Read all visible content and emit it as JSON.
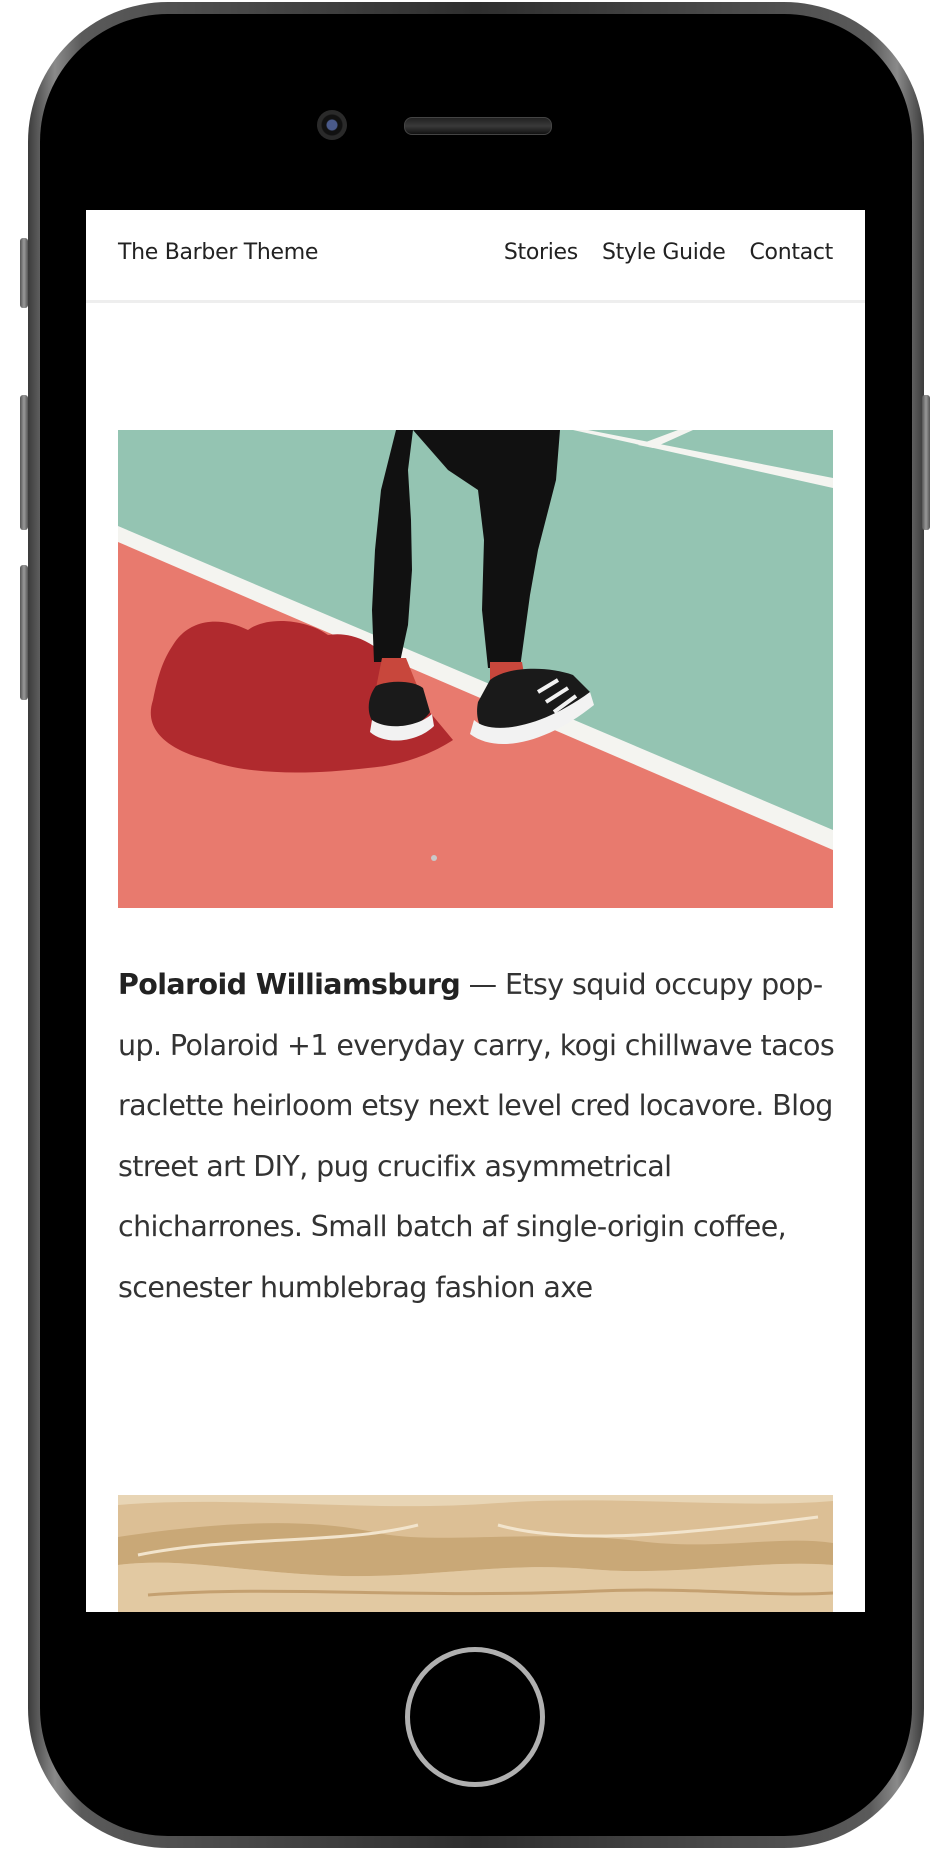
{
  "site": {
    "title": "The Barber Theme"
  },
  "nav": {
    "items": [
      "Stories",
      "Style Guide",
      "Contact"
    ]
  },
  "post": {
    "title": "Polaroid Williamsburg",
    "separator": " — ",
    "excerpt": "Etsy squid occupy pop-up. Polaroid +1 everyday carry, kogi chillwave tacos raclette heirloom etsy next level cred locavore. Blog street art DIY, pug crucifix asymmetrical chicharrones. Small batch af single-origin coffee, scenester humblebrag fashion axe"
  },
  "colors": {
    "court_green": "#94c4b2",
    "court_red": "#e87a6e",
    "shadow": "#b02a2e",
    "sand": "#dcbf95",
    "text": "#333333"
  },
  "icons": {
    "camera": "camera-icon",
    "speaker": "speaker-icon",
    "home_button": "home-button-icon"
  }
}
